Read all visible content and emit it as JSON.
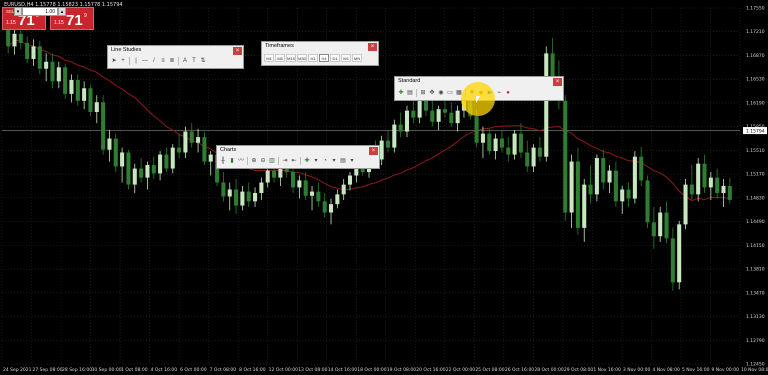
{
  "symbol_label": "EURUSD,H4  1.15778  1.15823  1.15778  1.15794",
  "trade_panel": {
    "sell_label": "SELL",
    "buy_label": "BUY",
    "lot_value": "1.00",
    "sell_price_small": "1.15",
    "sell_price_big": "71",
    "sell_price_sup": "8",
    "buy_price_small": "1.15",
    "buy_price_big": "71",
    "buy_price_sup": "9"
  },
  "toolbars": {
    "line_studies": {
      "title": "Line Studies",
      "close": "×"
    },
    "timeframes": {
      "title": "Timeframes",
      "close": "×",
      "items": [
        "M1",
        "M5",
        "M15",
        "M30",
        "H1",
        "H4",
        "D1",
        "W1",
        "MN"
      ],
      "active": "H4"
    },
    "standard": {
      "title": "Standard",
      "close": "×"
    },
    "charts": {
      "title": "Charts",
      "close": "×"
    }
  },
  "price_axis_labels": [
    "1.17550",
    "1.17210",
    "1.16870",
    "1.16530",
    "1.16190",
    "1.15850",
    "1.15510",
    "1.15170",
    "1.14830",
    "1.14490",
    "1.14150",
    "1.13810",
    "1.13470",
    "1.13130",
    "1.12790",
    "1.12450"
  ],
  "current_price_label": "1.15794",
  "time_axis_labels": [
    "24 Sep 2021",
    "27 Sep 08:00",
    "28 Sep 16:00",
    "30 Sep 00:00",
    "1 Oct 08:00",
    "4 Oct 16:00",
    "6 Oct 00:00",
    "7 Oct 08:00",
    "8 Oct 16:00",
    "12 Oct 00:00",
    "13 Oct 08:00",
    "14 Oct 16:00",
    "18 Oct 00:00",
    "19 Oct 08:00",
    "20 Oct 16:00",
    "22 Oct 00:00",
    "25 Oct 08:00",
    "26 Oct 16:00",
    "28 Oct 00:00",
    "29 Oct 08:00",
    "1 Nov 16:00",
    "3 Nov 00:00",
    "4 Nov 08:00",
    "5 Nov 16:00",
    "9 Nov 00:00",
    "10 Nov 08:00"
  ],
  "colors": {
    "background": "#000000",
    "grid": "#2a3a2a",
    "candle_bull": "#c8e6c0",
    "candle_bear": "#2e7d32",
    "moving_average": "#8b1a1a",
    "trade_red": "#c8252c"
  },
  "chart_data": {
    "type": "candlestick",
    "ylim": [
      1.1245,
      1.1755
    ],
    "ma_period": 21,
    "candles": [
      [
        1.1748,
        1.1755,
        1.169,
        1.17
      ],
      [
        1.17,
        1.1725,
        1.1688,
        1.1718
      ],
      [
        1.1718,
        1.174,
        1.1696,
        1.1705
      ],
      [
        1.1705,
        1.1714,
        1.1676,
        1.1682
      ],
      [
        1.1682,
        1.171,
        1.1672,
        1.17
      ],
      [
        1.17,
        1.1708,
        1.166,
        1.1668
      ],
      [
        1.1668,
        1.169,
        1.165,
        1.1678
      ],
      [
        1.1678,
        1.169,
        1.164,
        1.165
      ],
      [
        1.165,
        1.1678,
        1.164,
        1.167
      ],
      [
        1.167,
        1.1675,
        1.1625,
        1.1632
      ],
      [
        1.1632,
        1.166,
        1.162,
        1.1652
      ],
      [
        1.1652,
        1.166,
        1.1615,
        1.1622
      ],
      [
        1.1622,
        1.165,
        1.161,
        1.164
      ],
      [
        1.164,
        1.1645,
        1.16,
        1.1606
      ],
      [
        1.1606,
        1.163,
        1.159,
        1.162
      ],
      [
        1.162,
        1.163,
        1.1545,
        1.1552
      ],
      [
        1.1552,
        1.158,
        1.1535,
        1.1568
      ],
      [
        1.1568,
        1.1575,
        1.152,
        1.1528
      ],
      [
        1.1528,
        1.1555,
        1.1505,
        1.1548
      ],
      [
        1.1548,
        1.1552,
        1.1495,
        1.1502
      ],
      [
        1.1502,
        1.1532,
        1.149,
        1.1525
      ],
      [
        1.1525,
        1.154,
        1.1505,
        1.1512
      ],
      [
        1.1512,
        1.1535,
        1.1495,
        1.153
      ],
      [
        1.153,
        1.1542,
        1.151,
        1.1518
      ],
      [
        1.1518,
        1.155,
        1.1508,
        1.1545
      ],
      [
        1.1545,
        1.1555,
        1.152,
        1.1525
      ],
      [
        1.1525,
        1.156,
        1.1518,
        1.1555
      ],
      [
        1.1555,
        1.1575,
        1.154,
        1.1548
      ],
      [
        1.1548,
        1.1585,
        1.154,
        1.1578
      ],
      [
        1.1578,
        1.159,
        1.1555,
        1.1562
      ],
      [
        1.1562,
        1.1582,
        1.1548,
        1.157
      ],
      [
        1.157,
        1.1578,
        1.153,
        1.1535
      ],
      [
        1.1535,
        1.155,
        1.1515,
        1.1545
      ],
      [
        1.1545,
        1.1552,
        1.15,
        1.1505
      ],
      [
        1.1505,
        1.152,
        1.1478,
        1.1485
      ],
      [
        1.1485,
        1.1505,
        1.1465,
        1.1495
      ],
      [
        1.1495,
        1.151,
        1.146,
        1.1472
      ],
      [
        1.1472,
        1.15,
        1.1465,
        1.1492
      ],
      [
        1.1492,
        1.1505,
        1.147,
        1.1478
      ],
      [
        1.1478,
        1.1498,
        1.147,
        1.149
      ],
      [
        1.149,
        1.1512,
        1.148,
        1.1505
      ],
      [
        1.1505,
        1.153,
        1.1498,
        1.1522
      ],
      [
        1.1522,
        1.154,
        1.1505,
        1.1512
      ],
      [
        1.1512,
        1.1535,
        1.15,
        1.1528
      ],
      [
        1.1528,
        1.1545,
        1.1512,
        1.152
      ],
      [
        1.152,
        1.1535,
        1.149,
        1.1498
      ],
      [
        1.1498,
        1.1515,
        1.1482,
        1.1508
      ],
      [
        1.1508,
        1.152,
        1.148,
        1.1486
      ],
      [
        1.1486,
        1.15,
        1.1465,
        1.1492
      ],
      [
        1.1492,
        1.1505,
        1.147,
        1.1478
      ],
      [
        1.1478,
        1.149,
        1.1455,
        1.1462
      ],
      [
        1.1462,
        1.1482,
        1.1445,
        1.1474
      ],
      [
        1.1474,
        1.1495,
        1.1468,
        1.1488
      ],
      [
        1.1488,
        1.151,
        1.148,
        1.1502
      ],
      [
        1.1502,
        1.152,
        1.1494,
        1.1515
      ],
      [
        1.1515,
        1.154,
        1.1505,
        1.1532
      ],
      [
        1.1532,
        1.1548,
        1.1515,
        1.152
      ],
      [
        1.152,
        1.1552,
        1.1512,
        1.1545
      ],
      [
        1.1545,
        1.1565,
        1.153,
        1.1538
      ],
      [
        1.1538,
        1.1572,
        1.153,
        1.1565
      ],
      [
        1.1565,
        1.158,
        1.1548,
        1.1555
      ],
      [
        1.1555,
        1.1595,
        1.1548,
        1.1588
      ],
      [
        1.1588,
        1.1605,
        1.157,
        1.1578
      ],
      [
        1.1578,
        1.1615,
        1.157,
        1.1608
      ],
      [
        1.1608,
        1.1622,
        1.159,
        1.1598
      ],
      [
        1.1598,
        1.163,
        1.159,
        1.1622
      ],
      [
        1.1622,
        1.1635,
        1.16,
        1.1608
      ],
      [
        1.1608,
        1.1625,
        1.1585,
        1.1592
      ],
      [
        1.1592,
        1.1615,
        1.158,
        1.161
      ],
      [
        1.161,
        1.1622,
        1.1598,
        1.1605
      ],
      [
        1.1605,
        1.162,
        1.1585,
        1.159
      ],
      [
        1.159,
        1.1615,
        1.1578,
        1.1608
      ],
      [
        1.1608,
        1.163,
        1.1598,
        1.1622
      ],
      [
        1.1622,
        1.1632,
        1.1595,
        1.16
      ],
      [
        1.16,
        1.161,
        1.1555,
        1.1562
      ],
      [
        1.1562,
        1.1585,
        1.154,
        1.1575
      ],
      [
        1.1575,
        1.1582,
        1.1545,
        1.155
      ],
      [
        1.155,
        1.1575,
        1.1538,
        1.1568
      ],
      [
        1.1568,
        1.158,
        1.1548,
        1.1555
      ],
      [
        1.1555,
        1.157,
        1.1535,
        1.1545
      ],
      [
        1.1545,
        1.158,
        1.1538,
        1.1575
      ],
      [
        1.1575,
        1.159,
        1.154,
        1.1548
      ],
      [
        1.1548,
        1.1565,
        1.152,
        1.1528
      ],
      [
        1.1528,
        1.156,
        1.152,
        1.1555
      ],
      [
        1.1555,
        1.157,
        1.1535,
        1.1542
      ],
      [
        1.1542,
        1.17,
        1.1535,
        1.169
      ],
      [
        1.169,
        1.1712,
        1.164,
        1.1648
      ],
      [
        1.1648,
        1.168,
        1.161,
        1.1622
      ],
      [
        1.1622,
        1.163,
        1.145,
        1.1462
      ],
      [
        1.1462,
        1.1545,
        1.144,
        1.1535
      ],
      [
        1.1535,
        1.1555,
        1.143,
        1.144
      ],
      [
        1.144,
        1.151,
        1.142,
        1.1502
      ],
      [
        1.1502,
        1.153,
        1.1475,
        1.1488
      ],
      [
        1.1488,
        1.1545,
        1.1478,
        1.154
      ],
      [
        1.154,
        1.1552,
        1.1495,
        1.1505
      ],
      [
        1.1505,
        1.153,
        1.149,
        1.1522
      ],
      [
        1.1522,
        1.1535,
        1.147,
        1.1478
      ],
      [
        1.1478,
        1.15,
        1.146,
        1.1495
      ],
      [
        1.1495,
        1.1505,
        1.147,
        1.1482
      ],
      [
        1.1482,
        1.155,
        1.1475,
        1.1542
      ],
      [
        1.1542,
        1.1556,
        1.15,
        1.1508
      ],
      [
        1.1508,
        1.1515,
        1.144,
        1.1448
      ],
      [
        1.1448,
        1.147,
        1.141,
        1.1428
      ],
      [
        1.1428,
        1.147,
        1.142,
        1.1462
      ],
      [
        1.1462,
        1.1478,
        1.1418,
        1.1425
      ],
      [
        1.1425,
        1.144,
        1.135,
        1.1362
      ],
      [
        1.1362,
        1.145,
        1.1352,
        1.1445
      ],
      [
        1.1445,
        1.151,
        1.1438,
        1.1502
      ],
      [
        1.1502,
        1.153,
        1.148,
        1.1488
      ],
      [
        1.1488,
        1.154,
        1.1478,
        1.1532
      ],
      [
        1.1532,
        1.1545,
        1.149,
        1.1498
      ],
      [
        1.1498,
        1.152,
        1.148,
        1.1512
      ],
      [
        1.1512,
        1.1525,
        1.1482,
        1.149
      ],
      [
        1.149,
        1.151,
        1.147,
        1.15
      ],
      [
        1.15,
        1.1512,
        1.1475,
        1.148
      ]
    ]
  }
}
